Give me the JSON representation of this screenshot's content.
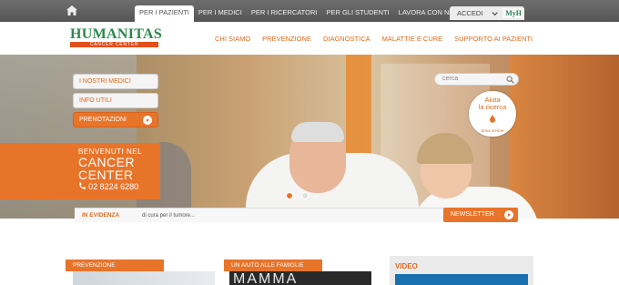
{
  "topbar": {
    "links": [
      "PER I PAZIENTI",
      "PER I MEDICI",
      "PER I RICERCATORI",
      "PER GLI STUDENTI",
      "LAVORA CON NOI"
    ],
    "active_index": 0,
    "accedi": "ACCEDI",
    "myh": "MyH"
  },
  "logo": {
    "main": "HUMANITAS",
    "sub": "CANCER CENTER"
  },
  "mainnav": [
    "CHI SIAMO",
    "PREVENZIONE",
    "DIAGNOSTICA",
    "MALATTIE E CURE",
    "SUPPORTO AI PAZIENTI"
  ],
  "hero": {
    "buttons": [
      "I NOSTRI MEDICI",
      "INFO UTILI",
      "PRENOTAZIONI"
    ],
    "welcome": {
      "line1": "BENVENUTI NEL",
      "line2": "CANCER",
      "line3": "CENTER",
      "phone": "02 8224 6280"
    },
    "search_placeholder": "cerca",
    "aiuta": {
      "line1": "Aiuta",
      "line2": "la ricerca",
      "line3": "dona on-line"
    }
  },
  "evidenza": {
    "label": "IN EVIDENZA",
    "text": "di cura per il tumore...",
    "newsletter": "NEWSLETTER"
  },
  "cards": {
    "prevenzione": "PREVENZIONE",
    "famiglie": "UN AIUTO ALLE FAMIGLIE",
    "mamma": "MAMMA",
    "video": "VIDEO"
  },
  "colors": {
    "accent": "#e8742a",
    "brand_green": "#2a8a4a",
    "topbar": "#5f5f5f"
  }
}
